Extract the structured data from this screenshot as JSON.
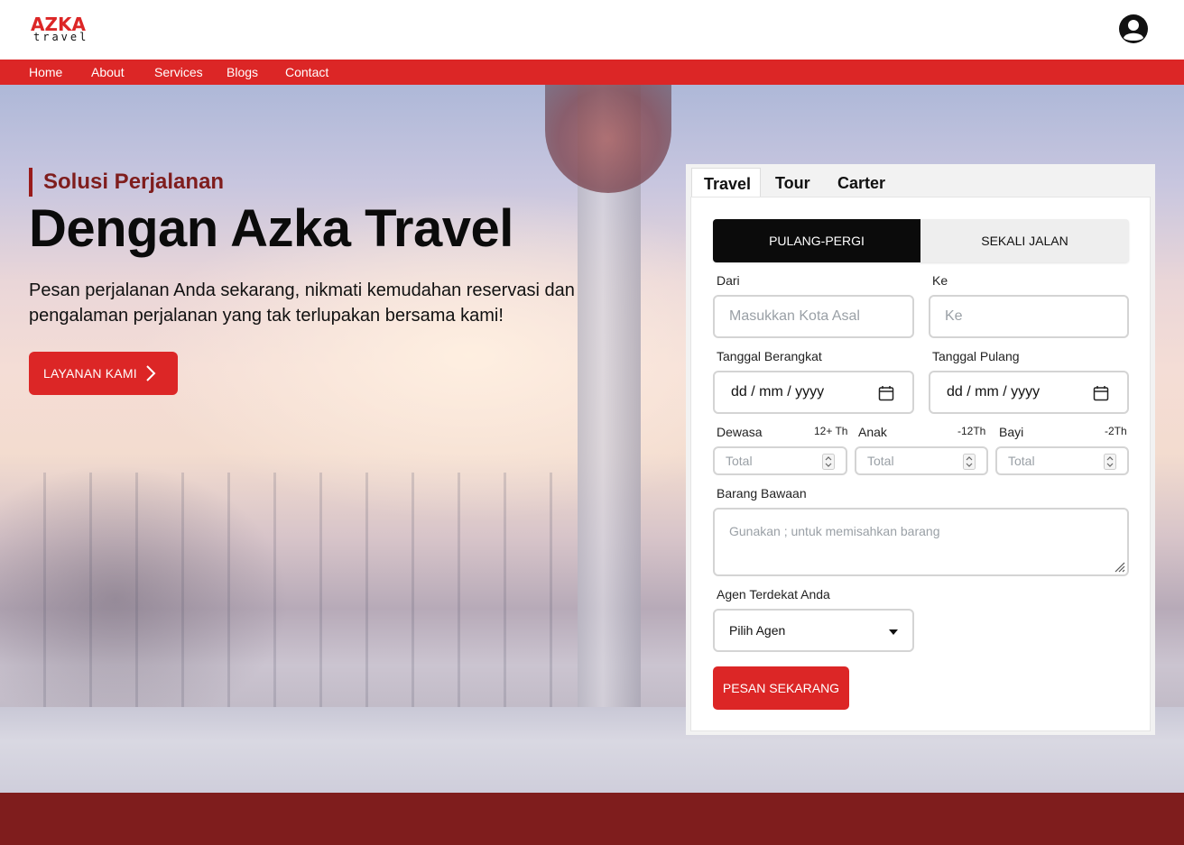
{
  "brand": {
    "logo_top": "AZKA",
    "logo_bottom": "travel"
  },
  "nav": {
    "items": [
      "Home",
      "About",
      "Services",
      "Blogs",
      "Contact"
    ]
  },
  "hero": {
    "kicker": "Solusi Perjalanan",
    "headline": "Dengan Azka Travel",
    "subtext_line1": "Pesan perjalanan Anda sekarang, nikmati kemudahan reservasi dan",
    "subtext_line2": "pengalaman perjalanan yang tak terlupakan bersama kami!",
    "cta_label": "LAYANAN KAMI"
  },
  "booking": {
    "tabs": [
      "Travel",
      "Tour",
      "Carter"
    ],
    "active_tab": "Travel",
    "trip_types": [
      "PULANG-PERGI",
      "SEKALI JALAN"
    ],
    "active_trip_type": "PULANG-PERGI",
    "from_label": "Dari",
    "from_placeholder": "Masukkan Kota Asal",
    "to_label": "Ke",
    "to_placeholder": "Ke",
    "depart_label": "Tanggal Berangkat",
    "return_label": "Tanggal Pulang",
    "date_placeholder": "dd / mm / yyyy",
    "adult_label": "Dewasa",
    "adult_hint": "12+ Th",
    "child_label": "Anak",
    "child_hint": "-12Th",
    "infant_label": "Bayi",
    "infant_hint": "-2Th",
    "count_placeholder": "Total",
    "luggage_label": "Barang Bawaan",
    "luggage_placeholder": "Gunakan ; untuk memisahkan barang",
    "agent_label": "Agen Terdekat Anda",
    "agent_selected": "Pilih Agen",
    "submit_label": "PESAN SEKARANG"
  },
  "colors": {
    "accent": "#dc2626",
    "dark_red": "#7f1d1d",
    "toggle_active": "#0b0b0b"
  },
  "icons": {
    "user": "user-circle-icon",
    "cta": "chevron-right-icon",
    "date": "calendar-icon",
    "select": "caret-down-icon"
  }
}
